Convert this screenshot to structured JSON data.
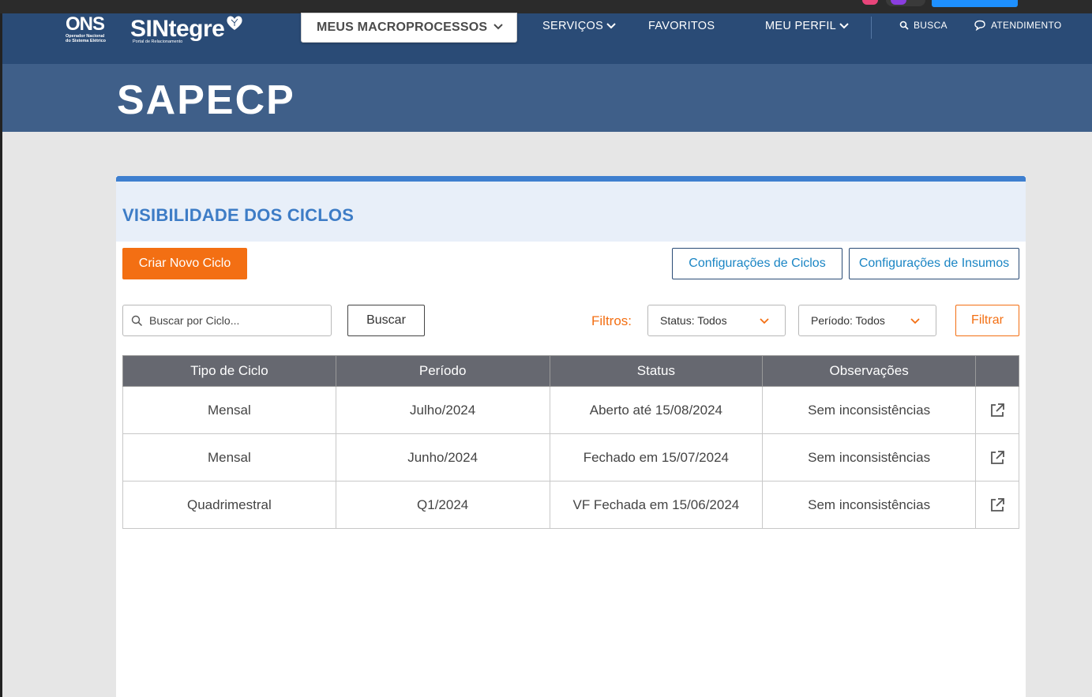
{
  "logo": {
    "ons": "ONS",
    "ons_sub1": "Operador Nacional",
    "ons_sub2": "do Sistema Elétrico",
    "sintegre": "SINtegre",
    "sintegre_sub": "Portal de Relacionamento"
  },
  "nav": {
    "macro": "MEUS MACROPROCESSOS",
    "servicos": "SERVIÇOS",
    "favoritos": "FAVORITOS",
    "perfil": "MEU PERFIL",
    "busca": "BUSCA",
    "atendimento": "ATENDIMENTO"
  },
  "banner": {
    "title": "SAPECP"
  },
  "card": {
    "title": "VISIBILIDADE DOS CICLOS",
    "create_label": "Criar Novo Ciclo",
    "config_ciclos": "Configurações de Ciclos",
    "config_insumos": "Configurações de Insumos"
  },
  "search": {
    "placeholder": "Buscar por Ciclo...",
    "button": "Buscar"
  },
  "filters": {
    "label": "Filtros:",
    "status": "Status: Todos",
    "periodo": "Período: Todos",
    "button": "Filtrar"
  },
  "table": {
    "headers": [
      "Tipo de Ciclo",
      "Período",
      "Status",
      "Observações",
      ""
    ],
    "rows": [
      [
        "Mensal",
        "Julho/2024",
        "Aberto até 15/08/2024",
        "Sem inconsistências"
      ],
      [
        "Mensal",
        "Junho/2024",
        "Fechado em 15/07/2024",
        "Sem inconsistências"
      ],
      [
        "Quadrimestral",
        "Q1/2024",
        "VF Fechada em 15/06/2024",
        "Sem inconsistências"
      ]
    ]
  },
  "colors": {
    "nav": "#2a4b76",
    "banner": "#3f5f89",
    "accent_orange": "#f36f13",
    "title_blue": "#3d7cc6",
    "table_header": "#666870"
  }
}
